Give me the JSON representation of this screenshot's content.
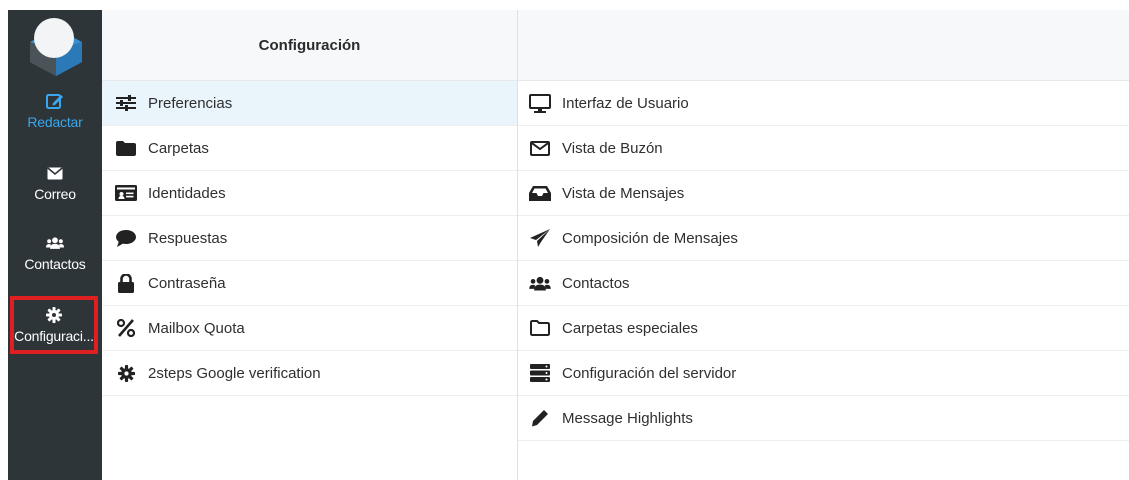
{
  "sidebar": {
    "items": [
      {
        "label": "Redactar",
        "icon": "compose-icon"
      },
      {
        "label": "Correo",
        "icon": "envelope-icon"
      },
      {
        "label": "Contactos",
        "icon": "users-icon"
      },
      {
        "label": "Configuraci...",
        "icon": "gear-icon"
      }
    ]
  },
  "settings": {
    "title": "Configuración",
    "items": [
      {
        "label": "Preferencias",
        "icon": "sliders-icon"
      },
      {
        "label": "Carpetas",
        "icon": "folder-icon"
      },
      {
        "label": "Identidades",
        "icon": "id-card-icon"
      },
      {
        "label": "Respuestas",
        "icon": "speech-bubble-icon"
      },
      {
        "label": "Contraseña",
        "icon": "lock-icon"
      },
      {
        "label": "Mailbox Quota",
        "icon": "percent-icon"
      },
      {
        "label": "2steps Google verification",
        "icon": "gear-icon"
      }
    ]
  },
  "preferences": {
    "items": [
      {
        "label": "Interfaz de Usuario",
        "icon": "monitor-icon"
      },
      {
        "label": "Vista de Buzón",
        "icon": "envelope-outline-icon"
      },
      {
        "label": "Vista de Mensajes",
        "icon": "inbox-icon"
      },
      {
        "label": "Composición de Mensajes",
        "icon": "paper-plane-icon"
      },
      {
        "label": "Contactos",
        "icon": "users-icon"
      },
      {
        "label": "Carpetas especiales",
        "icon": "folder-outline-icon"
      },
      {
        "label": "Configuración del servidor",
        "icon": "server-icon"
      },
      {
        "label": "Message Highlights",
        "icon": "pencil-icon"
      }
    ]
  },
  "colors": {
    "sidebar_bg": "#2e3538",
    "accent": "#37a7ee",
    "selected_outline": "#e02020",
    "active_row_bg": "#eaf4fb"
  }
}
